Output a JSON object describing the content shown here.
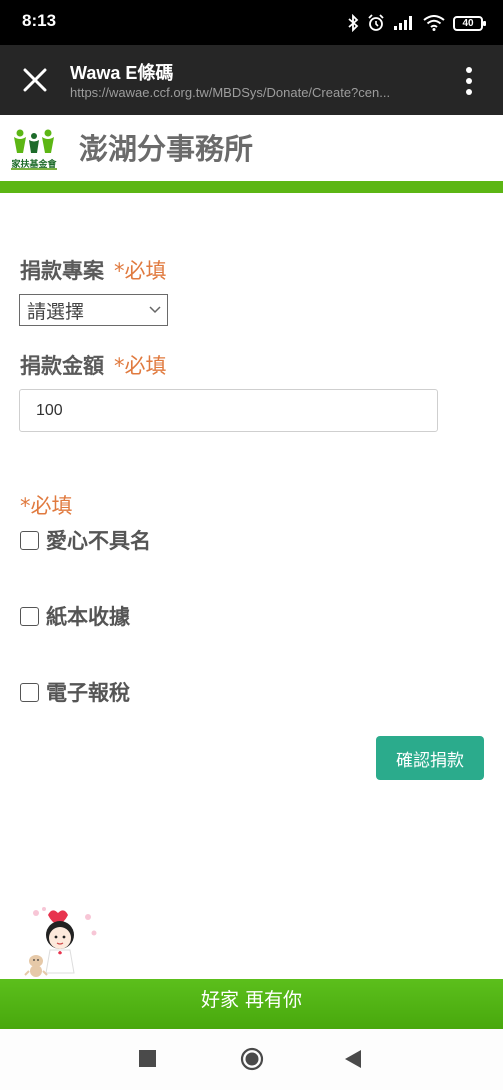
{
  "status_bar": {
    "time": "8:13",
    "battery": "40",
    "icons": [
      "bluetooth-icon",
      "alarm-icon",
      "signal-icon",
      "wifi-icon",
      "battery-icon"
    ]
  },
  "browser": {
    "title": "Wawa E條碼",
    "url": "https://wawae.ccf.org.tw/MBDSys/Donate/Create?cen..."
  },
  "header": {
    "logo_caption": "家扶基金會",
    "office_name": "澎湖分事務所"
  },
  "form": {
    "project_label": "捐款專案",
    "project_required": "*必填",
    "project_select_value": "請選擇",
    "amount_label": "捐款金額",
    "amount_required": "*必填",
    "amount_value": "100",
    "options_required": "*必填",
    "option_anonymous": "愛心不具名",
    "option_paper_receipt": "紙本收據",
    "option_e_tax": "電子報稅",
    "confirm_button": "確認捐款"
  },
  "footer": {
    "slogan": "好家 再有你"
  },
  "colors": {
    "brand_green": "#5cb614",
    "required_orange": "#e07a3f",
    "confirm_teal": "#2bab8c",
    "browser_bar": "#262626"
  }
}
